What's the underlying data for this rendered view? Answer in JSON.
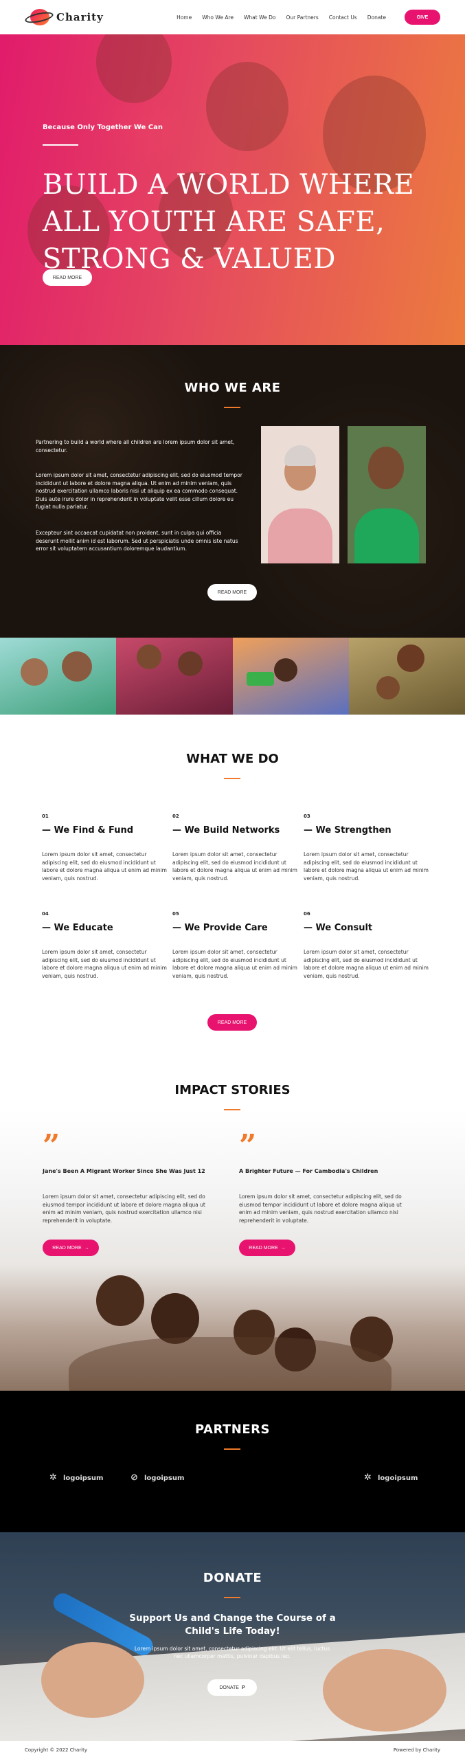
{
  "header": {
    "logo_text": "Charity",
    "nav": [
      "Home",
      "Who We Are",
      "What We Do",
      "Our Partners",
      "Contact Us",
      "Donate"
    ],
    "give_label": "GIVE"
  },
  "colors": {
    "accent": "#e8136f",
    "orange": "#f07a2a",
    "dark": "#000000"
  },
  "hero": {
    "eyebrow": "Because Only Together We Can",
    "title": "BUILD A WORLD WHERE ALL YOUTH ARE SAFE, STRONG & VALUED",
    "button": "READ MORE"
  },
  "who": {
    "title": "WHO WE ARE",
    "p1": "Partnering to build a world where all children are lorem ipsum dolor sit amet, consectetur.",
    "p2": "Lorem ipsum dolor sit amet, consectetur adipiscing elit, sed do eiusmod tempor incididunt ut labore et dolore magna aliqua. Ut enim ad minim veniam, quis nostrud exercitation ullamco laboris nisi ut aliquip ex ea commodo consequat. Duis aute irure dolor in reprehenderit in voluptate velit esse cillum dolore eu fugiat nulla pariatur.",
    "p3": "Excepteur sint occaecat cupidatat non proident, sunt in culpa qui officia deserunt mollit anim id est laborum. Sed ut perspiciatis unde omnis iste natus error sit voluptatem accusantium doloremque laudantium.",
    "button": "READ MORE"
  },
  "what": {
    "title": "WHAT WE DO",
    "items": [
      {
        "num": "01",
        "title": "— We Find & Fund",
        "body": "Lorem ipsum dolor sit amet, consectetur adipiscing elit, sed do eiusmod incididunt ut labore et dolore magna aliqua ut enim ad minim veniam, quis nostrud."
      },
      {
        "num": "02",
        "title": "— We Build Networks",
        "body": "Lorem ipsum dolor sit amet, consectetur adipiscing elit, sed do eiusmod incididunt ut labore et dolore magna aliqua ut enim ad minim veniam, quis nostrud."
      },
      {
        "num": "03",
        "title": "— We Strengthen",
        "body": "Lorem ipsum dolor sit amet, consectetur adipiscing elit, sed do eiusmod incididunt ut labore et dolore magna aliqua ut enim ad minim veniam, quis nostrud."
      },
      {
        "num": "04",
        "title": "— We Educate",
        "body": "Lorem ipsum dolor sit amet, consectetur adipiscing elit, sed do eiusmod incididunt ut labore et dolore magna aliqua ut enim ad minim veniam, quis nostrud."
      },
      {
        "num": "05",
        "title": "— We Provide Care",
        "body": "Lorem ipsum dolor sit amet, consectetur adipiscing elit, sed do eiusmod incididunt ut labore et dolore magna aliqua ut enim ad minim veniam, quis nostrud."
      },
      {
        "num": "06",
        "title": "— We Consult",
        "body": "Lorem ipsum dolor sit amet, consectetur adipiscing elit, sed do eiusmod incididunt ut labore et dolore magna aliqua ut enim ad minim veniam, quis nostrud."
      }
    ],
    "button": "READ MORE"
  },
  "impact": {
    "title": "IMPACT STORIES",
    "stories": [
      {
        "title": "Jane's Been A Migrant Worker Since She Was Just 12",
        "body": "Lorem ipsum dolor sit amet, consectetur adipiscing elit, sed do eiusmod tempor incididunt ut labore et dolore magna aliqua ut enim ad minim veniam, quis nostrud exercitation ullamco nisi reprehenderit in voluptate.",
        "button": "READ MORE"
      },
      {
        "title": "A Brighter Future — For Cambodia's Children",
        "body": "Lorem ipsum dolor sit amet, consectetur adipiscing elit, sed do eiusmod tempor incididunt ut labore et dolore magna aliqua ut enim ad minim veniam, quis nostrud exercitation ullamco nisi reprehenderit in voluptate.",
        "button": "READ MORE"
      }
    ]
  },
  "partners": {
    "title": "PARTNERS",
    "logos": [
      "logoipsum",
      "logoipsum",
      "logoipsum"
    ]
  },
  "donate": {
    "title": "DONATE",
    "subtitle_line1": "Support Us and Change the Course of a",
    "subtitle_line2": "Child's Life Today!",
    "body": "Lorem ipsum dolor sit amet, consectetur adipiscing elit. Ut elit tellus, luctus nec ullamcorper mattis, pulvinar dapibus leo.",
    "button": "DONATE"
  },
  "footer": {
    "copyright": "Copyright © 2022 Charity",
    "powered": "Powered by Charity"
  }
}
